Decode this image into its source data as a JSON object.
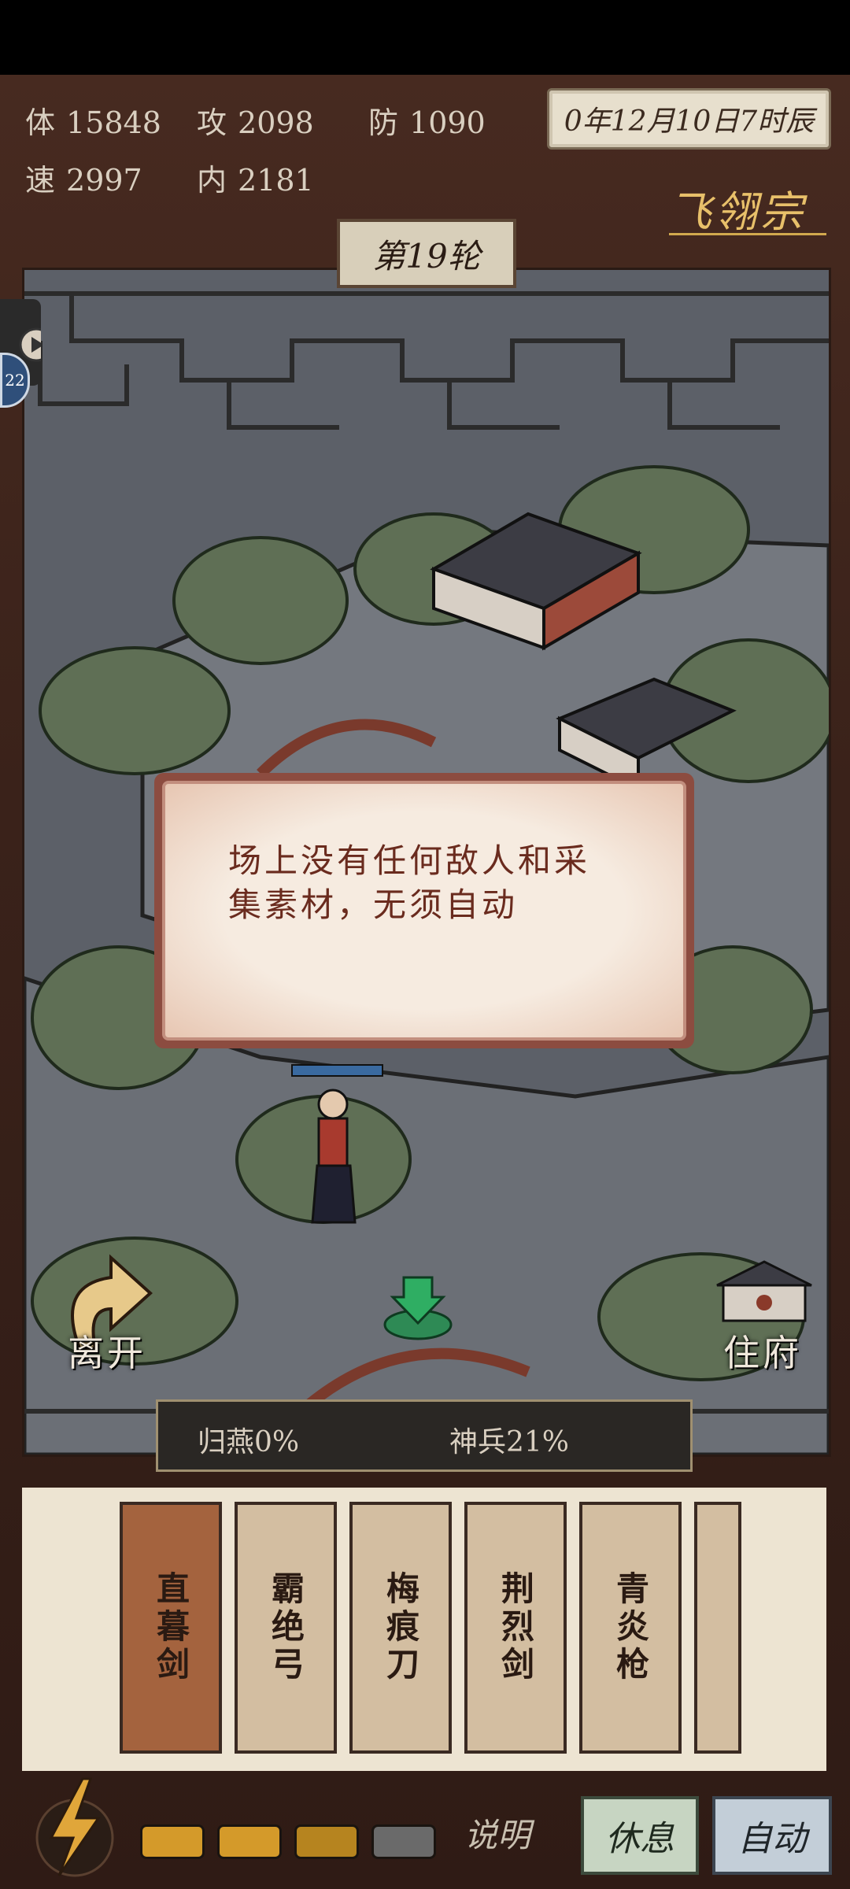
{
  "stats": {
    "hp": {
      "key": "体",
      "value": "15848"
    },
    "atk": {
      "key": "攻",
      "value": "2098"
    },
    "def": {
      "key": "防",
      "value": "1090"
    },
    "spd": {
      "key": "速",
      "value": "2997"
    },
    "inner": {
      "key": "内",
      "value": "2181"
    }
  },
  "date": "0年12月10日7时辰",
  "sect": "飞翎宗",
  "round": "第19轮",
  "side_badge": "22",
  "dialog_text": "场上没有任何敌人和采集素材，无须自动",
  "map_buttons": {
    "leave": "离开",
    "home": "住府"
  },
  "progress": {
    "guiyan": "归燕0%",
    "shenbing": "神兵21%"
  },
  "cards": [
    "直暮剑",
    "霸绝弓",
    "梅痕刀",
    "荆烈剑",
    "青炎枪"
  ],
  "bottom": {
    "explain": "说明",
    "rest": "休息",
    "auto": "自动"
  },
  "energy": {
    "filled": 3,
    "total": 4
  },
  "colors": {
    "accent": "#e8c06a",
    "card_active": "#a4633e",
    "dialog_text": "#6a2b1e"
  }
}
